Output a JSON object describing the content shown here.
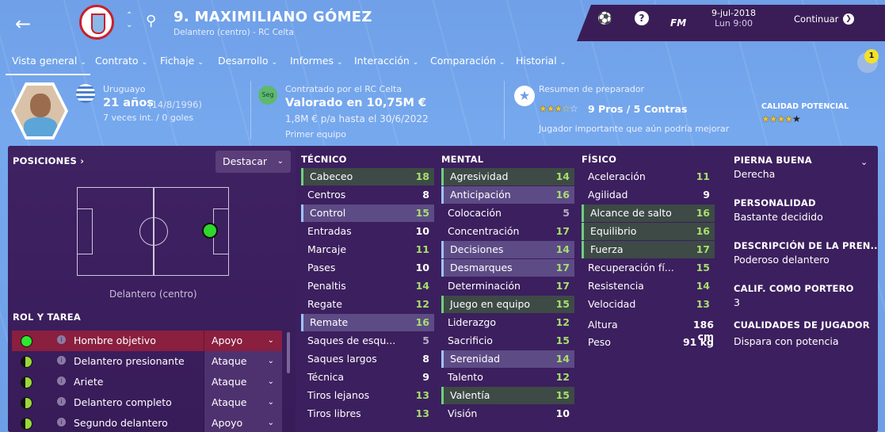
{
  "header": {
    "player_title": "9. MAXIMILIANO GÓMEZ",
    "player_sub": "Delantero (centro) - RC Celta",
    "fm_label": "FM",
    "date": "9-jul-2018",
    "time": "Lun 9:00",
    "continue_label": "Continuar",
    "help_label": "?"
  },
  "tabs": [
    "Vista general",
    "Contrato",
    "Fichaje",
    "Desarrollo",
    "Informes",
    "Interacción",
    "Comparación",
    "Historial"
  ],
  "notification_count": "1",
  "profile": {
    "nationality": "Uruguayo",
    "age": "21 años",
    "dob": "(14/8/1996)",
    "caps": "7 veces int. / 0 goles",
    "contract_label": "Contratado por el RC Celta",
    "value": "Valorado en 10,75M €",
    "wage": "1,8M € p/a hasta el 30/6/2022",
    "squad_status": "Primer equipo",
    "seg_badge": "Seg",
    "coach_summary_label": "Resumen de preparador",
    "coach_summary": "9 Pros / 5 Contras",
    "coach_comment": "Jugador importante que aún podría mejorar",
    "potential_label": "CALIDAD POTENCIAL",
    "current_ability_stars": 3.5,
    "potential_stars": 4.5
  },
  "positions": {
    "header": "POSICIONES",
    "highlight_label": "Destacar",
    "position_label": "Delantero (centro)"
  },
  "roles": {
    "header": "ROL Y TAREA",
    "items": [
      {
        "name": "Hombre objetivo",
        "duty": "Apoyo"
      },
      {
        "name": "Delantero presionante",
        "duty": "Ataque"
      },
      {
        "name": "Ariete",
        "duty": "Ataque"
      },
      {
        "name": "Delantero completo",
        "duty": "Ataque"
      },
      {
        "name": "Segundo delantero",
        "duty": "Apoyo"
      }
    ]
  },
  "technical": {
    "header": "TÉCNICO",
    "attrs": [
      {
        "name": "Cabeceo",
        "value": "18"
      },
      {
        "name": "Centros",
        "value": "8"
      },
      {
        "name": "Control",
        "value": "15"
      },
      {
        "name": "Entradas",
        "value": "10"
      },
      {
        "name": "Marcaje",
        "value": "11"
      },
      {
        "name": "Pases",
        "value": "10"
      },
      {
        "name": "Penaltis",
        "value": "14"
      },
      {
        "name": "Regate",
        "value": "12"
      },
      {
        "name": "Remate",
        "value": "16"
      },
      {
        "name": "Saques de esqu...",
        "value": "5"
      },
      {
        "name": "Saques largos",
        "value": "8"
      },
      {
        "name": "Técnica",
        "value": "9"
      },
      {
        "name": "Tiros lejanos",
        "value": "13"
      },
      {
        "name": "Tiros libres",
        "value": "13"
      }
    ]
  },
  "mental": {
    "header": "MENTAL",
    "attrs": [
      {
        "name": "Agresividad",
        "value": "14"
      },
      {
        "name": "Anticipación",
        "value": "16"
      },
      {
        "name": "Colocación",
        "value": "5"
      },
      {
        "name": "Concentración",
        "value": "17"
      },
      {
        "name": "Decisiones",
        "value": "14"
      },
      {
        "name": "Desmarques",
        "value": "17"
      },
      {
        "name": "Determinación",
        "value": "17"
      },
      {
        "name": "Juego en equipo",
        "value": "15"
      },
      {
        "name": "Liderazgo",
        "value": "12"
      },
      {
        "name": "Sacrificio",
        "value": "15"
      },
      {
        "name": "Serenidad",
        "value": "14"
      },
      {
        "name": "Talento",
        "value": "12"
      },
      {
        "name": "Valentía",
        "value": "15"
      },
      {
        "name": "Visión",
        "value": "10"
      }
    ]
  },
  "physical": {
    "header": "FÍSICO",
    "attrs": [
      {
        "name": "Aceleración",
        "value": "11"
      },
      {
        "name": "Agilidad",
        "value": "9"
      },
      {
        "name": "Alcance de salto",
        "value": "16"
      },
      {
        "name": "Equilibrio",
        "value": "16"
      },
      {
        "name": "Fuerza",
        "value": "17"
      },
      {
        "name": "Recuperación fí...",
        "value": "15"
      },
      {
        "name": "Resistencia",
        "value": "14"
      },
      {
        "name": "Velocidad",
        "value": "13"
      }
    ],
    "height_label": "Altura",
    "height": "186 cm",
    "weight_label": "Peso",
    "weight": "91 kg"
  },
  "details": {
    "foot_label": "PIERNA BUENA",
    "foot": "Derecha",
    "personality_label": "PERSONALIDAD",
    "personality": "Bastante decidido",
    "press_label": "DESCRIPCIÓN DE LA PREN...",
    "press": "Poderoso delantero",
    "gk_label": "CALIF. COMO PORTERO",
    "gk": "3",
    "traits_label": "CUALIDADES DE JUGADOR",
    "traits": "Dispara con potencia"
  }
}
